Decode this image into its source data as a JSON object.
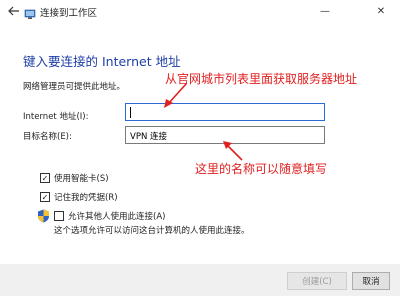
{
  "window": {
    "title": "连接到工作区",
    "back_icon": "back-arrow-icon",
    "minimize_symbol": "—",
    "close_symbol": "✕"
  },
  "main": {
    "heading": "键入要连接的 Internet 地址",
    "subtext": "网络管理员可提供此地址。",
    "internet_label": "Internet 地址(I):",
    "internet_value": "",
    "dest_label": "目标名称(E):",
    "dest_value": "VPN 连接"
  },
  "options": {
    "smartcard": {
      "label": "使用智能卡(S)",
      "checked": true
    },
    "remember": {
      "label": "记住我的凭据(R)",
      "checked": true
    },
    "allow_others": {
      "label": "允许其他人使用此连接(A)",
      "checked": false
    },
    "allow_desc": "这个选项允许可以访问这台计算机的人使用此连接。"
  },
  "annotations": {
    "top": "从官网城市列表里面获取服务器地址",
    "bottom": "这里的名称可以随意填写",
    "color": "#e02020"
  },
  "footer": {
    "create_label": "创建(C)",
    "cancel_label": "取消"
  },
  "colors": {
    "heading": "#1f3fa8",
    "focus_border": "#2a6ad8"
  }
}
